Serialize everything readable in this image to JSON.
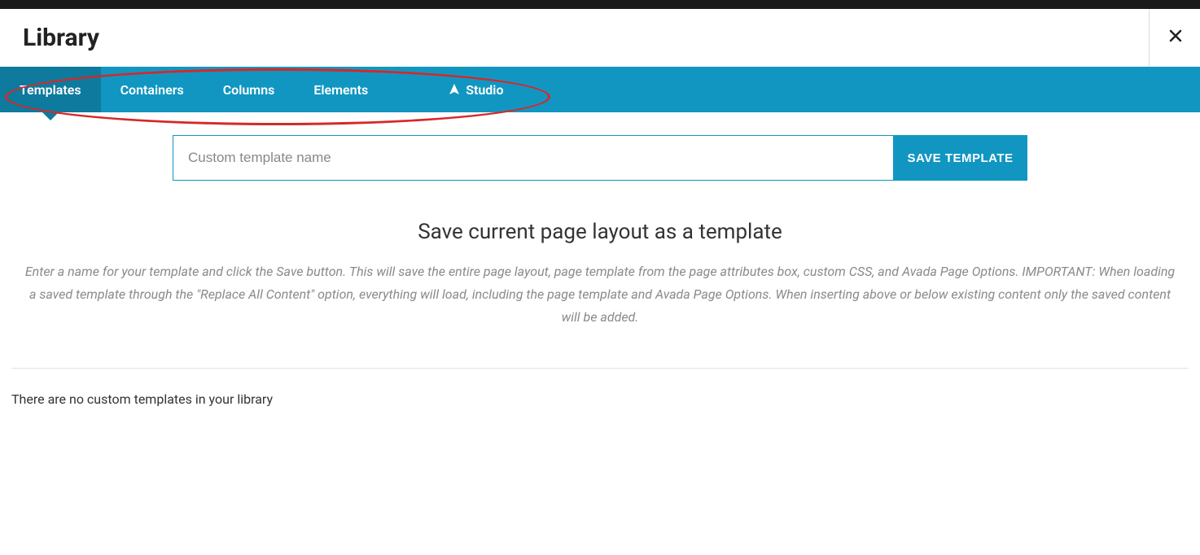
{
  "header": {
    "title": "Library"
  },
  "tabs": {
    "items": [
      {
        "label": "Templates",
        "active": true
      },
      {
        "label": "Containers",
        "active": false
      },
      {
        "label": "Columns",
        "active": false
      },
      {
        "label": "Elements",
        "active": false
      },
      {
        "label": "Studio",
        "active": false,
        "icon": true
      }
    ]
  },
  "save": {
    "placeholder": "Custom template name",
    "button_label": "SAVE TEMPLATE"
  },
  "section": {
    "title": "Save current page layout as a template",
    "help": "Enter a name for your template and click the Save button. This will save the entire page layout, page template from the page attributes box, custom CSS, and Avada Page Options. IMPORTANT: When loading a saved template through the \"Replace All Content\" option, everything will load, including the page template and Avada Page Options. When inserting above or below existing content only the saved content will be added."
  },
  "empty_message": "There are no custom templates in your library"
}
